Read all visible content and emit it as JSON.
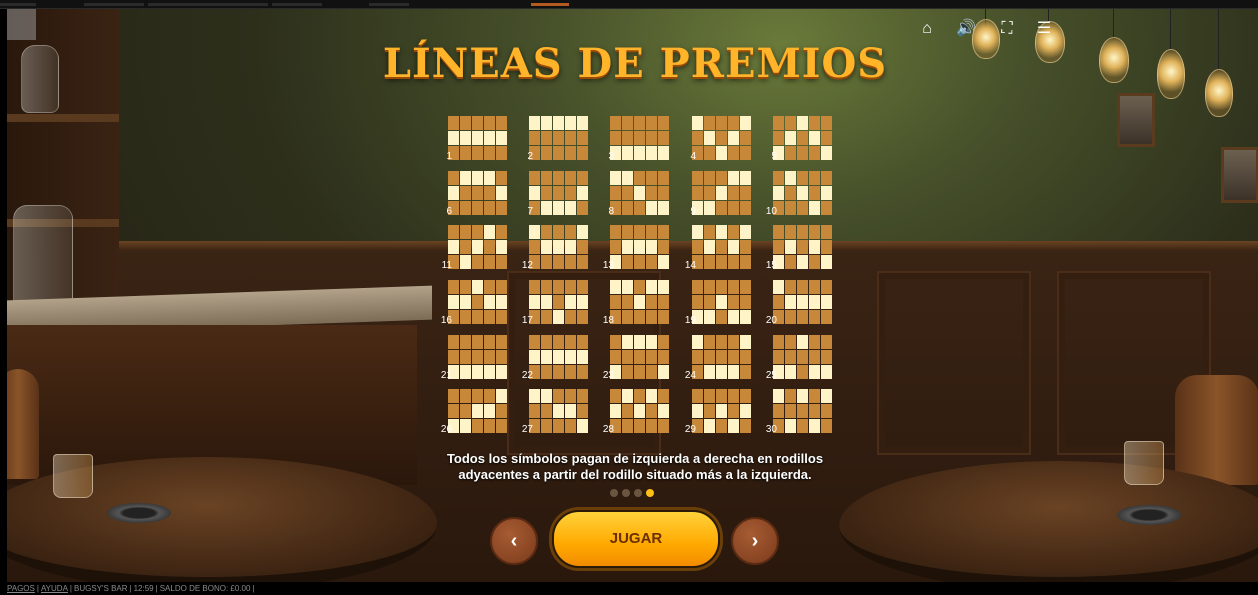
{
  "title": "LÍNEAS DE PREMIOS",
  "paylines": [
    {
      "number": "1",
      "pattern": [
        "00000",
        "11111",
        "00000"
      ]
    },
    {
      "number": "2",
      "pattern": [
        "11111",
        "00000",
        "00000"
      ]
    },
    {
      "number": "3",
      "pattern": [
        "00000",
        "00000",
        "11111"
      ]
    },
    {
      "number": "4",
      "pattern": [
        "10001",
        "01010",
        "00100"
      ]
    },
    {
      "number": "5",
      "pattern": [
        "00100",
        "01010",
        "10001"
      ]
    },
    {
      "number": "6",
      "pattern": [
        "01110",
        "10001",
        "00000"
      ]
    },
    {
      "number": "7",
      "pattern": [
        "00000",
        "10001",
        "01110"
      ]
    },
    {
      "number": "8",
      "pattern": [
        "11000",
        "00100",
        "00011"
      ]
    },
    {
      "number": "9",
      "pattern": [
        "00011",
        "00100",
        "11000"
      ]
    },
    {
      "number": "10",
      "pattern": [
        "01000",
        "10101",
        "00010"
      ]
    },
    {
      "number": "11",
      "pattern": [
        "00010",
        "10101",
        "01000"
      ]
    },
    {
      "number": "12",
      "pattern": [
        "10001",
        "01110",
        "00000"
      ]
    },
    {
      "number": "13",
      "pattern": [
        "00000",
        "01110",
        "10001"
      ]
    },
    {
      "number": "14",
      "pattern": [
        "10101",
        "01010",
        "00000"
      ]
    },
    {
      "number": "15",
      "pattern": [
        "00000",
        "01010",
        "10101"
      ]
    },
    {
      "number": "16",
      "pattern": [
        "00100",
        "11011",
        "00000"
      ]
    },
    {
      "number": "17",
      "pattern": [
        "00000",
        "11011",
        "00100"
      ]
    },
    {
      "number": "18",
      "pattern": [
        "11011",
        "00100",
        "00000"
      ]
    },
    {
      "number": "19",
      "pattern": [
        "00000",
        "00100",
        "11011"
      ]
    },
    {
      "number": "20",
      "pattern": [
        "10000",
        "01111",
        "00000"
      ]
    },
    {
      "number": "21",
      "pattern": [
        "00000",
        "00000",
        "11111"
      ]
    },
    {
      "number": "22",
      "pattern": [
        "00000",
        "11111",
        "00000"
      ]
    },
    {
      "number": "23",
      "pattern": [
        "01110",
        "00000",
        "10001"
      ]
    },
    {
      "number": "24",
      "pattern": [
        "10001",
        "00000",
        "01110"
      ]
    },
    {
      "number": "25",
      "pattern": [
        "00100",
        "00000",
        "11011"
      ]
    },
    {
      "number": "26",
      "pattern": [
        "00001",
        "00110",
        "11000"
      ]
    },
    {
      "number": "27",
      "pattern": [
        "11000",
        "00110",
        "00001"
      ]
    },
    {
      "number": "28",
      "pattern": [
        "01010",
        "10101",
        "00000"
      ]
    },
    {
      "number": "29",
      "pattern": [
        "00000",
        "10101",
        "01010"
      ]
    },
    {
      "number": "30",
      "pattern": [
        "10101",
        "00000",
        "01010"
      ]
    }
  ],
  "description_line1": "Todos los símbolos pagan de izquierda a derecha en rodillos",
  "description_line2": "adyacentes a partir del rodillo situado más a la izquierda.",
  "pagination": {
    "total": 4,
    "active": 4
  },
  "buttons": {
    "prev": "‹",
    "next": "›",
    "play": "JUGAR"
  },
  "hud": {
    "home": "home-icon",
    "sound": "speaker-icon",
    "fullscreen": "fullscreen-icon",
    "menu": "hamburger-menu-icon"
  },
  "status_bar": {
    "pagos": "PAGOS",
    "ayuda": "AYUDA",
    "game_name": "BUGSY'S BAR",
    "time": "12:59",
    "bonus_balance": "SALDO DE BONO: £0.00"
  },
  "colors": {
    "title": "#ffb42a",
    "cell_off": "#c8883a",
    "cell_on": "#fff3c8",
    "play_button": "#ffa900",
    "nav_button": "#8a4522",
    "active_dot": "#ffbf14"
  }
}
